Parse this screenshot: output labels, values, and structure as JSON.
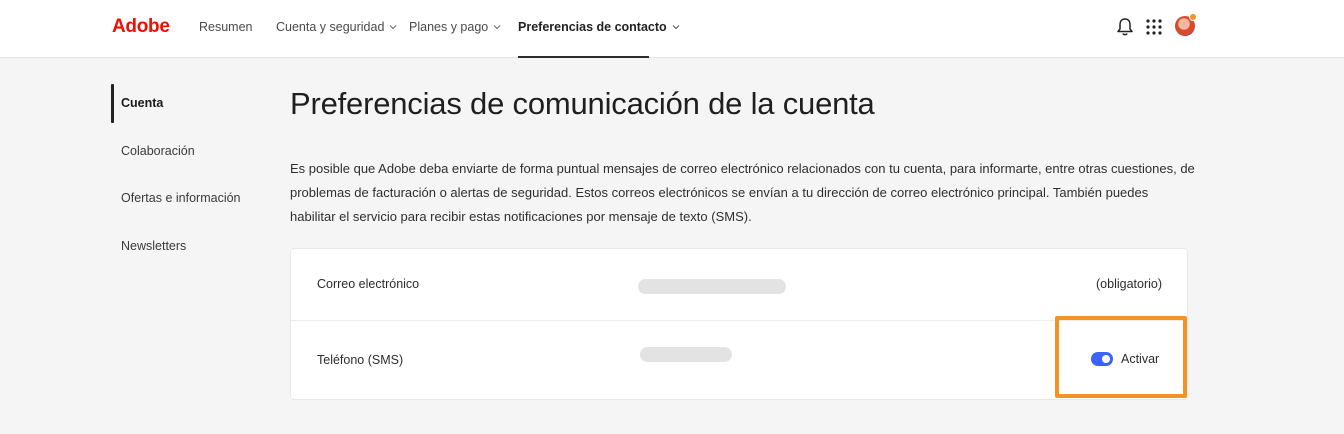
{
  "brand": {
    "logo_text": "Adobe",
    "logo_color": "#eb1000"
  },
  "topnav": {
    "items": [
      {
        "label": "Resumen",
        "has_dropdown": false,
        "active": false
      },
      {
        "label": "Cuenta y seguridad",
        "has_dropdown": true,
        "active": false
      },
      {
        "label": "Planes y pago",
        "has_dropdown": true,
        "active": false
      },
      {
        "label": "Preferencias de contacto",
        "has_dropdown": true,
        "active": true
      }
    ],
    "icons": [
      "bell-icon",
      "apps-grid-icon",
      "user-avatar"
    ]
  },
  "sidebar": {
    "items": [
      {
        "label": "Cuenta",
        "active": true
      },
      {
        "label": "Colaboración",
        "active": false
      },
      {
        "label": "Ofertas e información",
        "active": false
      },
      {
        "label": "Newsletters",
        "active": false
      }
    ]
  },
  "main": {
    "title": "Preferencias de comunicación de la cuenta",
    "description": "Es posible que Adobe deba enviarte de forma puntual mensajes de correo electrónico relacionados con tu cuenta, para informarte, entre otras cuestiones, de problemas de facturación o alertas de seguridad. Estos correos electrónicos se envían a tu dirección de correo electrónico principal. También puedes habilitar el servicio para recibir estas notificaciones por mensaje de texto (SMS).",
    "rows": [
      {
        "label": "Correo electrónico",
        "status": "(obligatorio)"
      },
      {
        "label": "Teléfono (SMS)",
        "toggle_label": "Activar",
        "toggle_on": true
      }
    ]
  },
  "colors": {
    "accent": "#3b63fb",
    "highlight": "#f29423",
    "text": "#2c2c2c"
  }
}
